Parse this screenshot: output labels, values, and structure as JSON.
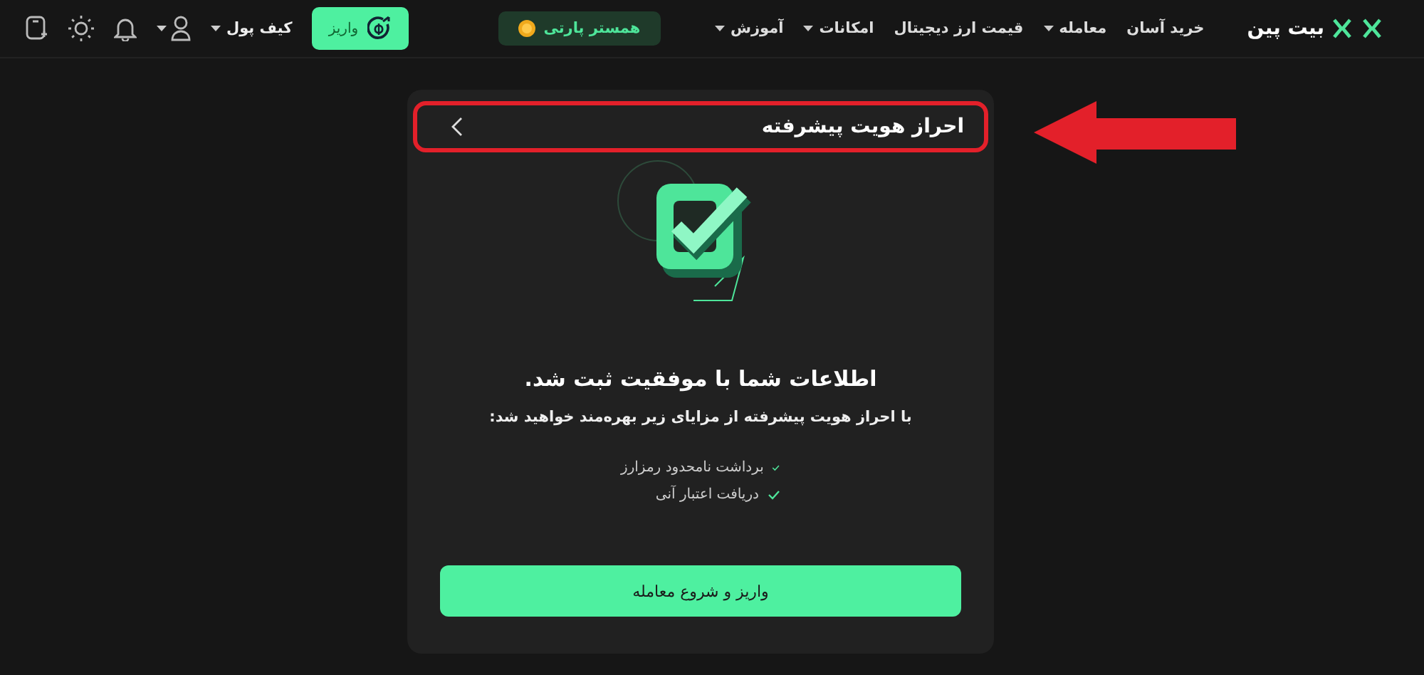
{
  "header": {
    "brand": "بیت پین",
    "nav": [
      {
        "label": "خرید آسان",
        "dropdown": false
      },
      {
        "label": "معامله",
        "dropdown": true
      },
      {
        "label": "قیمت ارز دیجیتال",
        "dropdown": false
      },
      {
        "label": "امکانات",
        "dropdown": true
      },
      {
        "label": "آموزش",
        "dropdown": true
      }
    ],
    "partner_button": "همستر پارتی",
    "deposit_button": "واریز",
    "wallet_menu": "کیف پول"
  },
  "card": {
    "title": "احراز هویت پیشرفته",
    "title_highlighted": true,
    "heading": "اطلاعات شما با موفقیت ثبت شد.",
    "subtitle": "با احراز هویت پیشرفته از مزایای زیر بهره‌مند خواهید شد:",
    "benefits": [
      "برداشت نامحدود رمزارز",
      "دریافت اعتبار آنی"
    ],
    "action_button": "واریز و شروع معامله"
  }
}
